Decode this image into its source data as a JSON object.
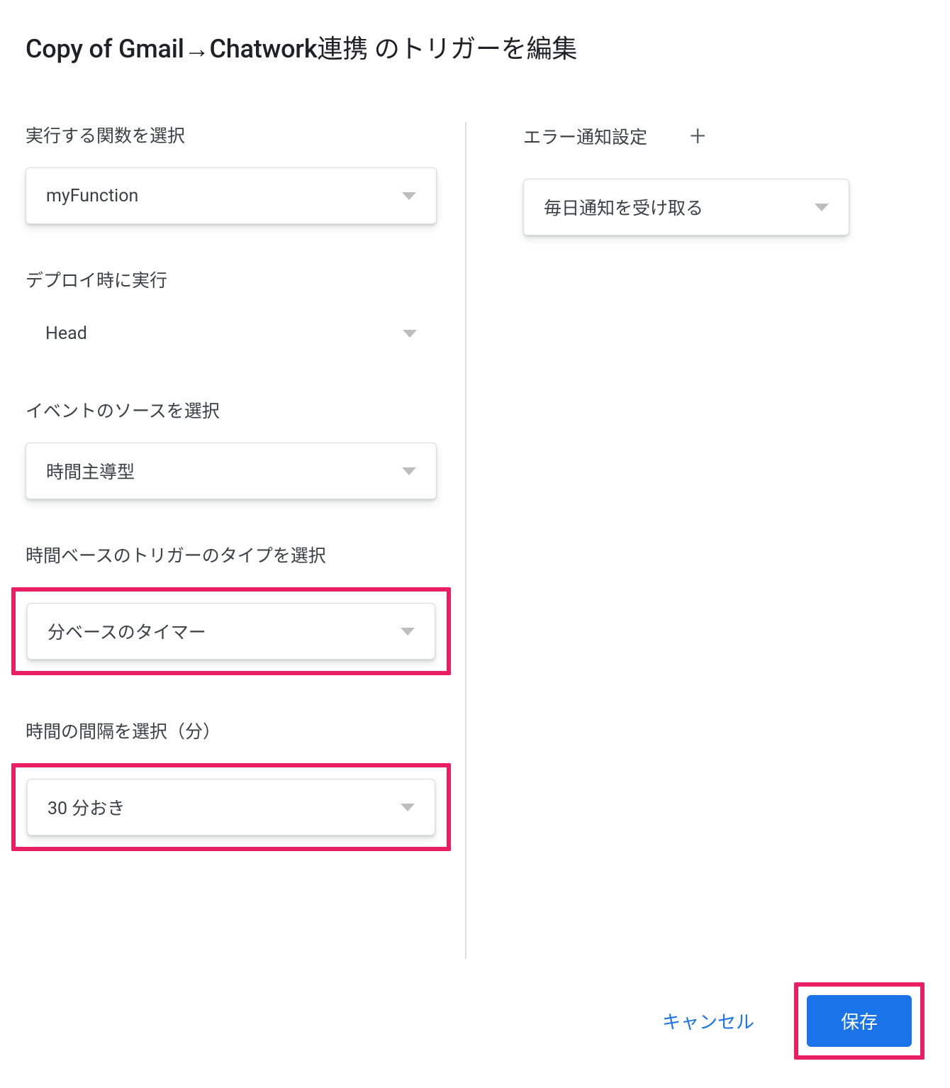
{
  "dialog": {
    "title": "Copy of Gmail→Chatwork連携 のトリガーを編集"
  },
  "left": {
    "function_label": "実行する関数を選択",
    "function_value": "myFunction",
    "deploy_label": "デプロイ時に実行",
    "deploy_value": "Head",
    "event_source_label": "イベントのソースを選択",
    "event_source_value": "時間主導型",
    "trigger_type_label": "時間ベースのトリガーのタイプを選択",
    "trigger_type_value": "分ベースのタイマー",
    "interval_label": "時間の間隔を選択（分）",
    "interval_value": "30 分おき"
  },
  "right": {
    "error_label": "エラー通知設定",
    "error_value": "毎日通知を受け取る"
  },
  "footer": {
    "cancel": "キャンセル",
    "save": "保存"
  }
}
